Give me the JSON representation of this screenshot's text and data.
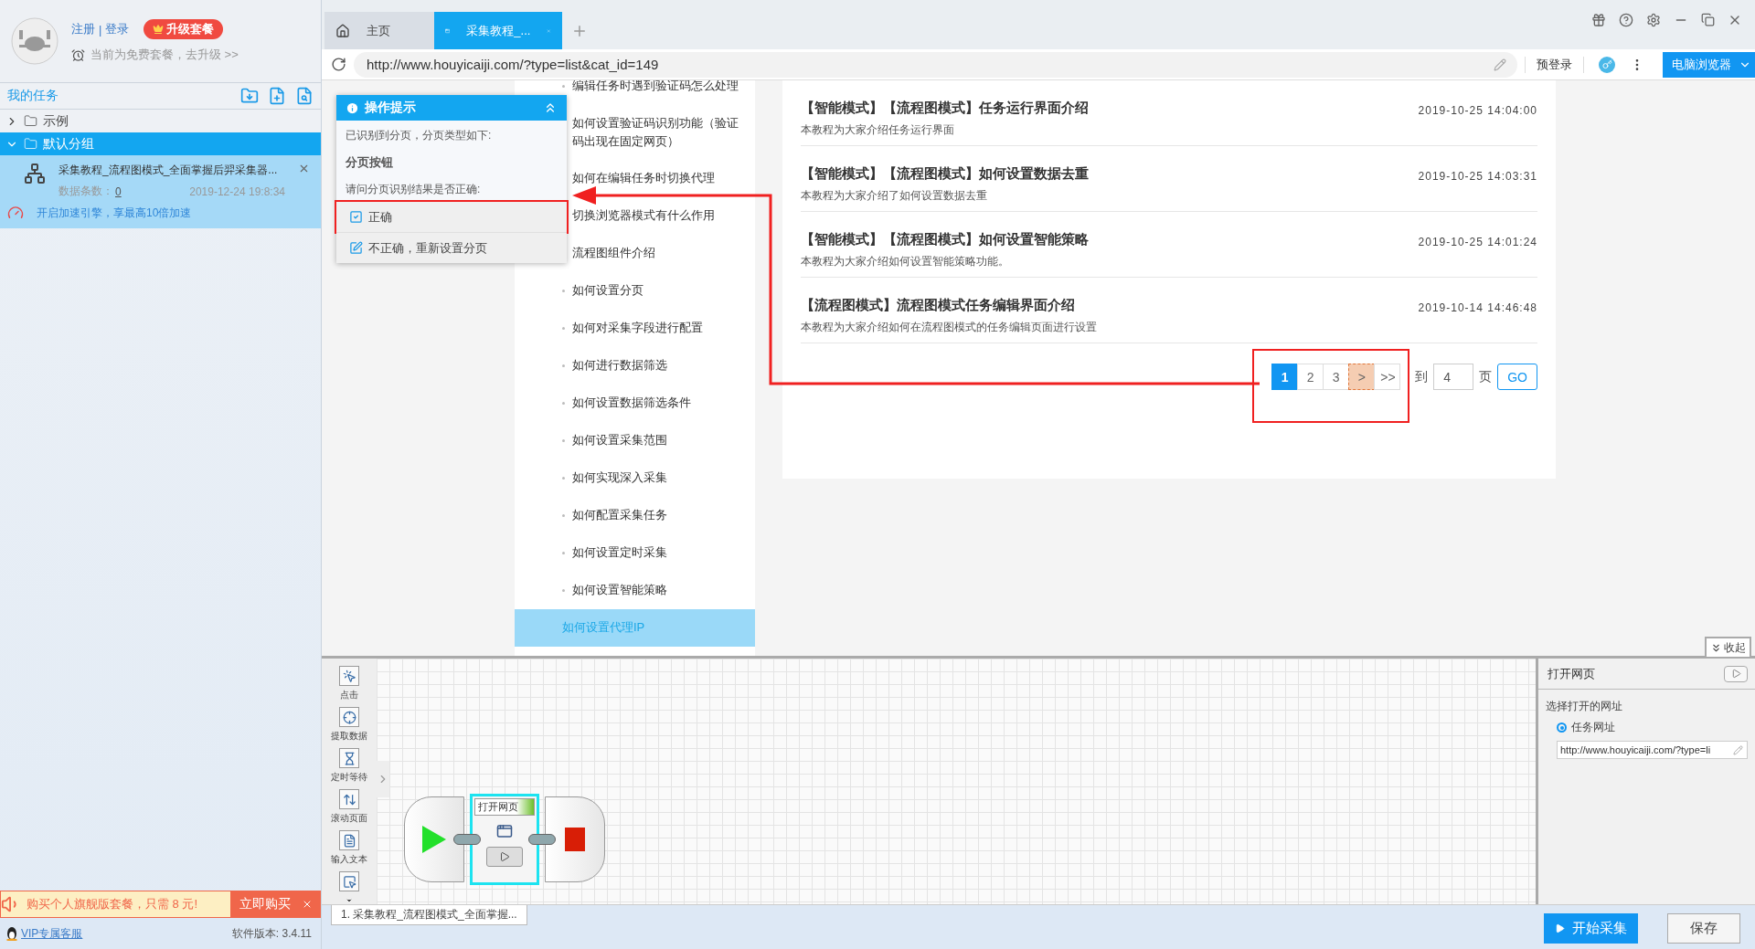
{
  "account": {
    "register": "注册",
    "separator": "|",
    "login": "登录",
    "upgrade": "升级套餐",
    "plan_note": "当前为免费套餐，去升级 >>"
  },
  "tasks": {
    "title": "我的任务",
    "groups": [
      {
        "name": "示例",
        "expanded": false,
        "selected": false
      },
      {
        "name": "默认分组",
        "expanded": true,
        "selected": true
      }
    ],
    "items": [
      {
        "title": "采集教程_流程图模式_全面掌握后羿采集器...",
        "count_label": "数据条数：",
        "count": "0",
        "time": "2019-12-24 19:8:34",
        "boost": "开启加速引擎，享最高10倍加速"
      }
    ]
  },
  "promo": {
    "text": "购买个人旗舰版套餐，只需 8 元!",
    "button": "立即购买"
  },
  "footer": {
    "support": "VIP专属客服",
    "version": "软件版本: 3.4.11"
  },
  "tabs": [
    {
      "label": "主页",
      "kind": "home",
      "selected": false
    },
    {
      "label": "采集教程_...",
      "kind": "page",
      "selected": true
    }
  ],
  "address": {
    "url": "http://www.houyicaiji.com/?type=list&cat_id=149",
    "prelogin": "预登录",
    "browser": "电脑浏览器"
  },
  "hint_popup": {
    "title": "操作提示",
    "detected": "已识别到分页，分页类型如下:",
    "type": "分页按钮",
    "question": "请问分页识别结果是否正确:",
    "options": [
      {
        "label": "正确",
        "kind": "confirm",
        "highlighted": true
      },
      {
        "label": "不正确，重新设置分页",
        "kind": "edit",
        "highlighted": false
      }
    ]
  },
  "site_menu": [
    {
      "label": "编辑任务时遇到验证码怎么处理",
      "selected": false
    },
    {
      "label": "如何设置验证码识别功能（验证码出现在固定网页）",
      "selected": false
    },
    {
      "label": "如何在编辑任务时切换代理",
      "selected": false
    },
    {
      "label": "切换浏览器模式有什么作用",
      "selected": false
    },
    {
      "label": "流程图组件介绍",
      "selected": false
    },
    {
      "label": "如何设置分页",
      "selected": false
    },
    {
      "label": "如何对采集字段进行配置",
      "selected": false
    },
    {
      "label": "如何进行数据筛选",
      "selected": false
    },
    {
      "label": "如何设置数据筛选条件",
      "selected": false
    },
    {
      "label": "如何设置采集范围",
      "selected": false
    },
    {
      "label": "如何实现深入采集",
      "selected": false
    },
    {
      "label": "如何配置采集任务",
      "selected": false
    },
    {
      "label": "如何设置定时采集",
      "selected": false
    },
    {
      "label": "如何设置智能策略",
      "selected": false
    },
    {
      "label": "如何设置代理IP",
      "selected": true
    }
  ],
  "articles": [
    {
      "title": "【智能模式】【流程图模式】任务运行界面介绍",
      "time": "2019-10-25 14:04:00",
      "summary": "本教程为大家介绍任务运行界面"
    },
    {
      "title": "【智能模式】【流程图模式】如何设置数据去重",
      "time": "2019-10-25 14:03:31",
      "summary": "本教程为大家介绍了如何设置数据去重"
    },
    {
      "title": "【智能模式】【流程图模式】如何设置智能策略",
      "time": "2019-10-25 14:01:24",
      "summary": "本教程为大家介绍如何设置智能策略功能。"
    },
    {
      "title": "【流程图模式】流程图模式任务编辑界面介绍",
      "time": "2019-10-14 14:46:48",
      "summary": "本教程为大家介绍如何在流程图模式的任务编辑页面进行设置"
    }
  ],
  "pagination": {
    "highlighted": true,
    "pages": [
      {
        "label": "1",
        "selected": true
      },
      {
        "label": "2",
        "selected": false
      },
      {
        "label": "3",
        "selected": false
      }
    ],
    "next": {
      "label": ">",
      "hovered": true
    },
    "last": ">>",
    "goto_label": "到",
    "goto_value": "4",
    "page_unit": "页",
    "go": "GO"
  },
  "collapse": "收起",
  "flow_tools": [
    {
      "label": "点击",
      "kind": "click"
    },
    {
      "label": "提取数据",
      "kind": "extract"
    },
    {
      "label": "定时等待",
      "kind": "wait"
    },
    {
      "label": "滚动页面",
      "kind": "scroll"
    },
    {
      "label": "输入文本",
      "kind": "input"
    },
    {
      "kind": "more"
    }
  ],
  "flow": {
    "nodes": [
      {
        "kind": "start"
      },
      {
        "kind": "open",
        "label": "打开网页",
        "selected": true
      },
      {
        "kind": "end"
      }
    ]
  },
  "props": {
    "title": "打开网页",
    "section": "选择打开的网址",
    "options": [
      {
        "label": "任务网址",
        "selected": true
      }
    ],
    "url": "http://www.houyicaiji.com/?type=li"
  },
  "task_tabs": [
    {
      "label": "1. 采集教程_流程图模式_全面掌握...",
      "selected": true
    }
  ],
  "actions": {
    "start": "开始采集",
    "save": "保存"
  }
}
